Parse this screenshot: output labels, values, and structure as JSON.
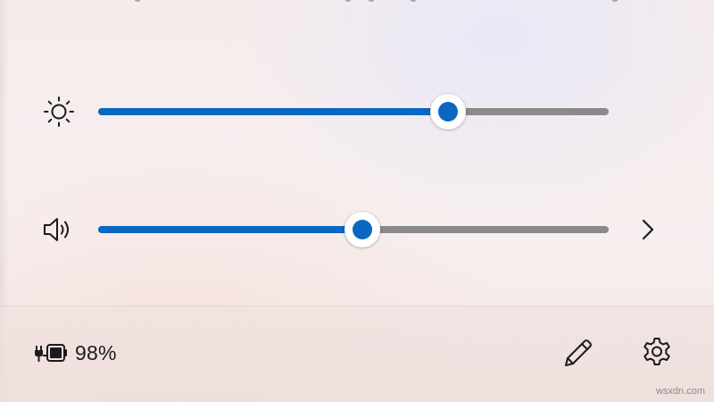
{
  "brightness": {
    "icon": "brightness-icon",
    "level": 0.686
  },
  "volume": {
    "icon": "speaker-icon",
    "level": 0.518,
    "expand_icon": "chevron-right-icon"
  },
  "battery": {
    "icon": "battery-charging-icon",
    "percent_label": "98%"
  },
  "footer": {
    "edit_icon": "pencil-icon",
    "settings_icon": "gear-icon"
  },
  "watermark": "wsxdn.com",
  "colors": {
    "accent": "#0a67c2",
    "track": "#8a8a8a",
    "icon": "#1b1b1b"
  }
}
